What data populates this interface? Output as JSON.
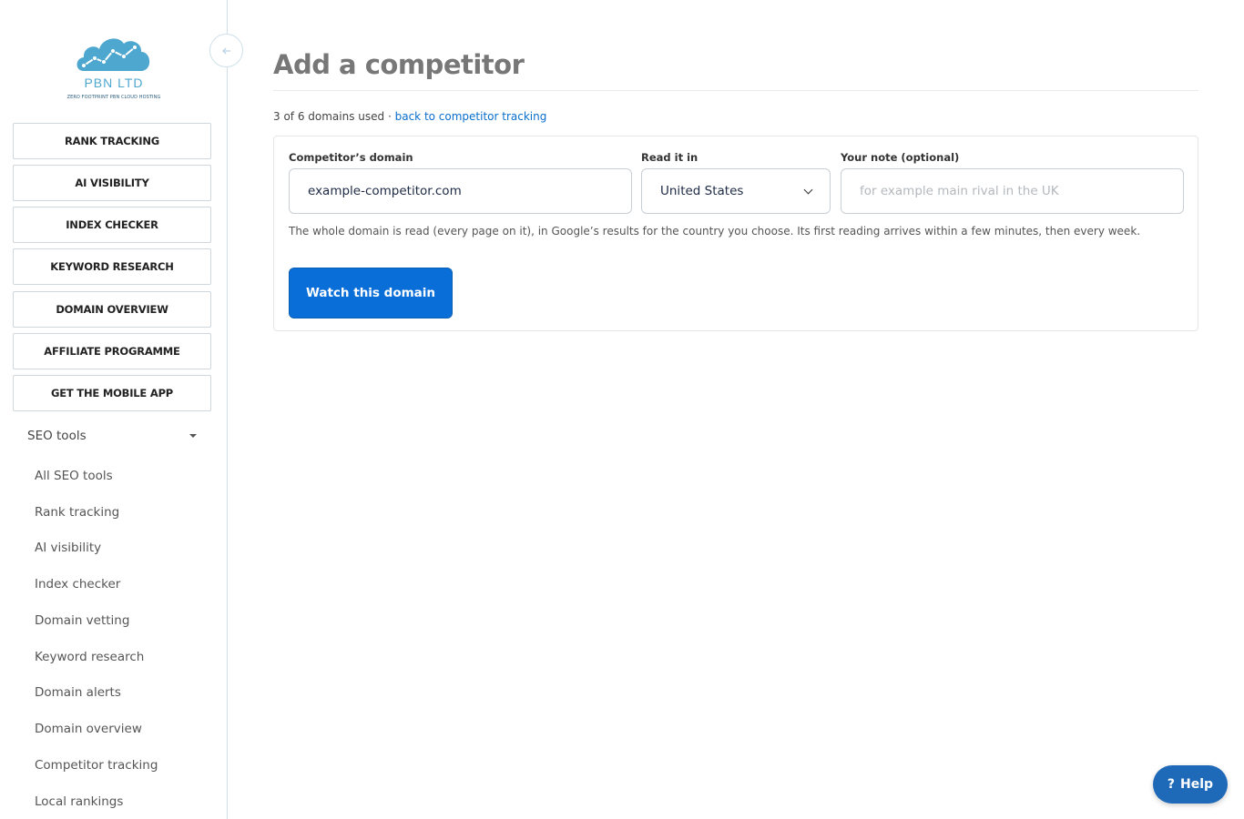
{
  "brand": {
    "name": "PBN LTD",
    "tagline": "ZERO FOOTPRINT PBN CLOUD HOSTING",
    "cloud_color": "#4ea7cf"
  },
  "sidebar": {
    "collapse_icon": "arrow-left-icon",
    "nav_buttons": [
      {
        "label": "RANK TRACKING"
      },
      {
        "label": "AI VISIBILITY"
      },
      {
        "label": "INDEX CHECKER"
      },
      {
        "label": "KEYWORD RESEARCH"
      },
      {
        "label": "DOMAIN OVERVIEW"
      },
      {
        "label": "AFFILIATE PROGRAMME"
      },
      {
        "label": "GET THE MOBILE APP"
      }
    ],
    "seo_tools": {
      "label": "SEO tools",
      "expanded": true,
      "items": [
        {
          "label": "All SEO tools"
        },
        {
          "label": "Rank tracking"
        },
        {
          "label": "AI visibility"
        },
        {
          "label": "Index checker"
        },
        {
          "label": "Domain vetting"
        },
        {
          "label": "Keyword research"
        },
        {
          "label": "Domain alerts"
        },
        {
          "label": "Domain overview"
        },
        {
          "label": "Competitor tracking"
        },
        {
          "label": "Local rankings"
        }
      ]
    }
  },
  "main": {
    "title": "Add a competitor",
    "usage_text": "3 of 6 domains used ·",
    "back_link": "back to competitor tracking",
    "form": {
      "domain_label": "Competitor’s domain",
      "domain_value": "example-competitor.com",
      "country_label": "Read it in",
      "country_value": "United States",
      "note_label": "Your note (optional)",
      "note_placeholder": "for example main rival in the UK",
      "help_text": "The whole domain is read (every page on it), in Google’s results for the country you choose. Its first reading arrives within a few minutes, then every week.",
      "submit_label": "Watch this domain"
    }
  },
  "help_button": {
    "icon": "?",
    "label": "Help",
    "color": "#1e69b8"
  },
  "colors": {
    "primary": "#0a6ed8",
    "link": "#0a6ecb",
    "title_gray": "#777777"
  }
}
